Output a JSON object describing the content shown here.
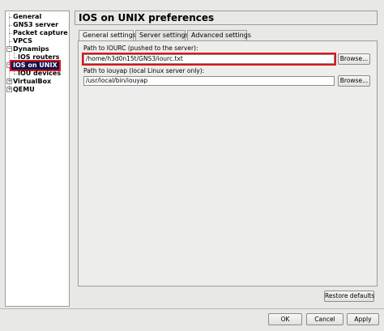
{
  "sidebar": {
    "items": [
      {
        "label": "General",
        "indent": 0
      },
      {
        "label": "GNS3 server",
        "indent": 0
      },
      {
        "label": "Packet capture",
        "indent": 0
      },
      {
        "label": "VPCS",
        "indent": 0
      },
      {
        "label": "Dynamips",
        "indent": 0,
        "expanded": true
      },
      {
        "label": "IOS routers",
        "indent": 1
      },
      {
        "label": "IOS on UNIX",
        "indent": 0,
        "expanded": true,
        "selected": true
      },
      {
        "label": "IOU devices",
        "indent": 1
      },
      {
        "label": "VirtualBox",
        "indent": 0,
        "collapsed": true
      },
      {
        "label": "QEMU",
        "indent": 0,
        "collapsed": true
      }
    ]
  },
  "header": {
    "title": "IOS on UNIX preferences"
  },
  "tabs": [
    {
      "label": "General settings",
      "active": true
    },
    {
      "label": "Server settings",
      "active": false
    },
    {
      "label": "Advanced settings",
      "active": false
    }
  ],
  "form": {
    "iourc_label": "Path to IOURC (pushed to the server):",
    "iourc_value": "/home/h3d0n15t/GNS3/iourc.txt",
    "iourc_browse": "Browse...",
    "iouyap_label": "Path to iouyap (local Linux server only):",
    "iouyap_value": "/usr/local/bin/iouyap",
    "iouyap_browse": "Browse..."
  },
  "restore_defaults": "Restore defaults",
  "dialog_buttons": {
    "ok": "OK",
    "cancel": "Cancel",
    "apply": "Apply"
  },
  "colors": {
    "selection": "#14124a",
    "highlight": "#e0121a"
  }
}
